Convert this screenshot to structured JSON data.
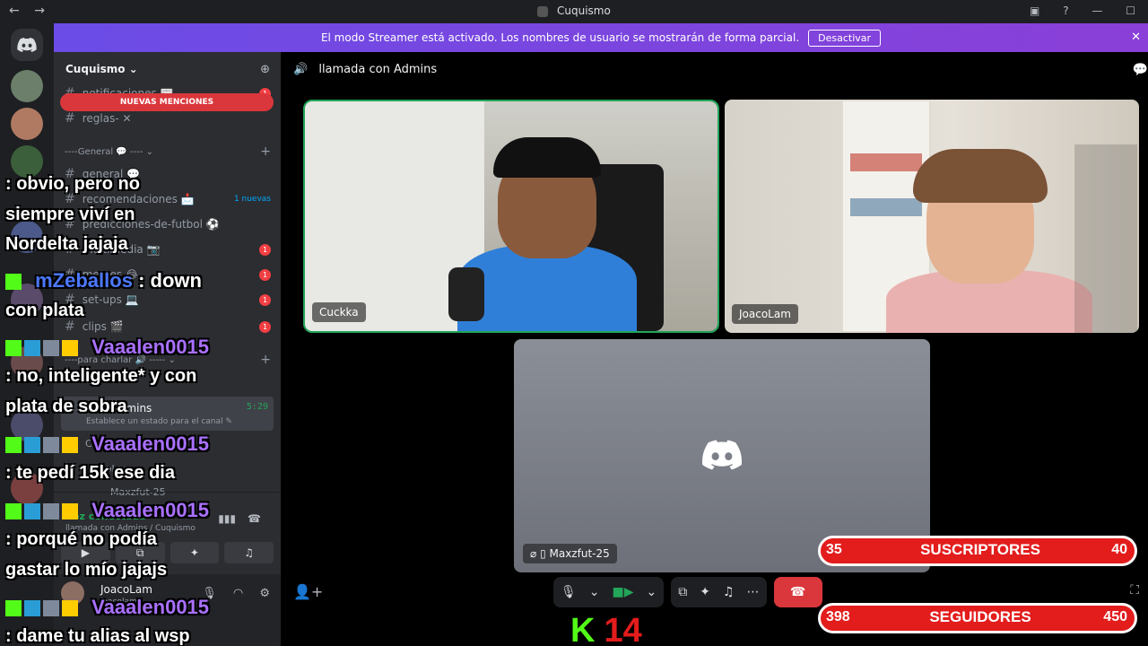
{
  "window": {
    "title": "Cuquismo",
    "back": "←",
    "forward": "→",
    "icons": [
      "inbox-icon",
      "help-icon",
      "minimize-icon",
      "maximize-icon"
    ]
  },
  "banner": {
    "text": "El modo Streamer está activado. Los nombres de usuario se mostrarán de forma parcial.",
    "button": "Desactivar",
    "close": "✕"
  },
  "sidebar": {
    "server_name": "Cuquismo ⌄",
    "new_mentions": "NUEVAS MENCIONES",
    "channels_top": [
      {
        "name": "notificaciones 📰",
        "badge": "1"
      },
      {
        "name": "reglas- ✕",
        "badge": ""
      }
    ],
    "category_general": "----General 💬 ---- ⌄",
    "channels_general": [
      {
        "name": "general 💬",
        "badge": ""
      },
      {
        "name": "recomendaciones 📩",
        "badge": "1 nuevas"
      },
      {
        "name": "predicciones-de-futbol ⚽",
        "badge": ""
      },
      {
        "name": "multimedia 📷",
        "badge": "1"
      },
      {
        "name": "memes 😂",
        "badge": "1"
      },
      {
        "name": "set-ups 💻",
        "badge": "1"
      },
      {
        "name": "clips 🎬",
        "badge": "1"
      }
    ],
    "category_charlar": "----para charlar 🔊 ----- ⌄",
    "voice_channel": {
      "name": "llamada con Admins",
      "visible_name": "...con Admins",
      "time": "5:29",
      "status": "Establece un estado para el canal ✎"
    },
    "voice_members": [
      "Cuckka",
      "JoacoLam",
      "Maxzfut-25"
    ],
    "rtc": {
      "status": "Voz conectada",
      "subtitle": "llamada con Admins / Cuquismo"
    },
    "user": {
      "name": "JoacoLam",
      "tag": "joacolam"
    }
  },
  "main": {
    "channel_header": "llamada con Admins",
    "tiles": [
      {
        "name": "Cuckka"
      },
      {
        "name": "JoacoLam"
      }
    ],
    "camera_off_tile": {
      "name": "Maxzfut-25"
    }
  },
  "overlay": {
    "chat": [
      {
        "type": "msg",
        "text": ": obvio, pero no"
      },
      {
        "type": "msg",
        "text": "siempre viví en"
      },
      {
        "type": "msg",
        "text": "Nordelta jajaja"
      },
      {
        "type": "user",
        "name": "mZeballos",
        "text": ": down"
      },
      {
        "type": "msg",
        "text": "con plata"
      },
      {
        "type": "user",
        "name": "Vaaalen0015",
        "text": ""
      },
      {
        "type": "msg",
        "text": ": no, inteligente* y con"
      },
      {
        "type": "msg",
        "text": "plata de sobra"
      },
      {
        "type": "user",
        "name": "Vaaalen0015",
        "text": ""
      },
      {
        "type": "msg",
        "text": ": te pedí 15k ese dia"
      },
      {
        "type": "user",
        "name": "Vaaalen0015",
        "text": ""
      },
      {
        "type": "msg",
        "text": ": porqué no podía"
      },
      {
        "type": "msg",
        "text": "gastar lo mío jajajs"
      },
      {
        "type": "user",
        "name": "Vaaalen0015",
        "text": ""
      },
      {
        "type": "msg",
        "text": ": dame tu alias al wsp"
      }
    ],
    "subscribers": {
      "current": "35",
      "label": "SUSCRIPTORES",
      "goal": "40"
    },
    "followers": {
      "current": "398",
      "label": "SEGUIDORES",
      "goal": "450"
    },
    "kick_logo": "K",
    "kick_count": "14"
  },
  "colors": {
    "banner": "#7b45e0",
    "speaking": "#23a55a",
    "hangup": "#da373c",
    "counter": "#e31c1c",
    "kick": "#53fc18"
  }
}
